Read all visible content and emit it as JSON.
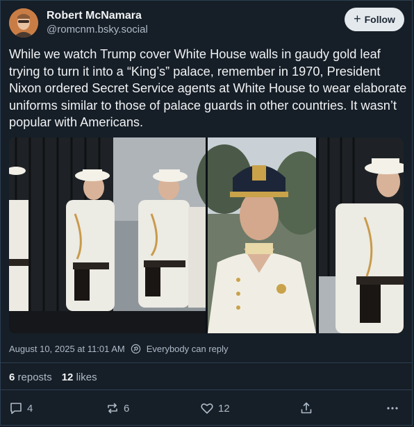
{
  "author": {
    "name": "Robert McNamara",
    "handle": "@romcnm.bsky.social"
  },
  "follow_button": {
    "label": "Follow"
  },
  "post": {
    "text": "While we watch Trump cover White House walls in gaudy gold leaf trying to turn it into a “King’s” palace, remember in 1970, President Nixon ordered Secret Service agents at White House to wear elaborate uniforms similar to those of palace guards in other countries. It wasn’t popular with Americans.",
    "timestamp": "August 10, 2025 at 11:01 AM",
    "reply_setting": "Everybody can reply"
  },
  "stats": {
    "reposts_count": "6",
    "reposts_label": "reposts",
    "likes_count": "12",
    "likes_label": "likes"
  },
  "actions": {
    "reply_count": "4",
    "repost_count": "6",
    "like_count": "12"
  },
  "icons": [
    "reply-icon",
    "repost-icon",
    "like-icon",
    "share-icon",
    "more-icon",
    "globe-icon"
  ],
  "colors": {
    "background": "#161e27",
    "text": "#f1f3f5",
    "muted": "#aebbc9",
    "follow_bg": "#e4e9ee",
    "divider": "#2e4052"
  }
}
